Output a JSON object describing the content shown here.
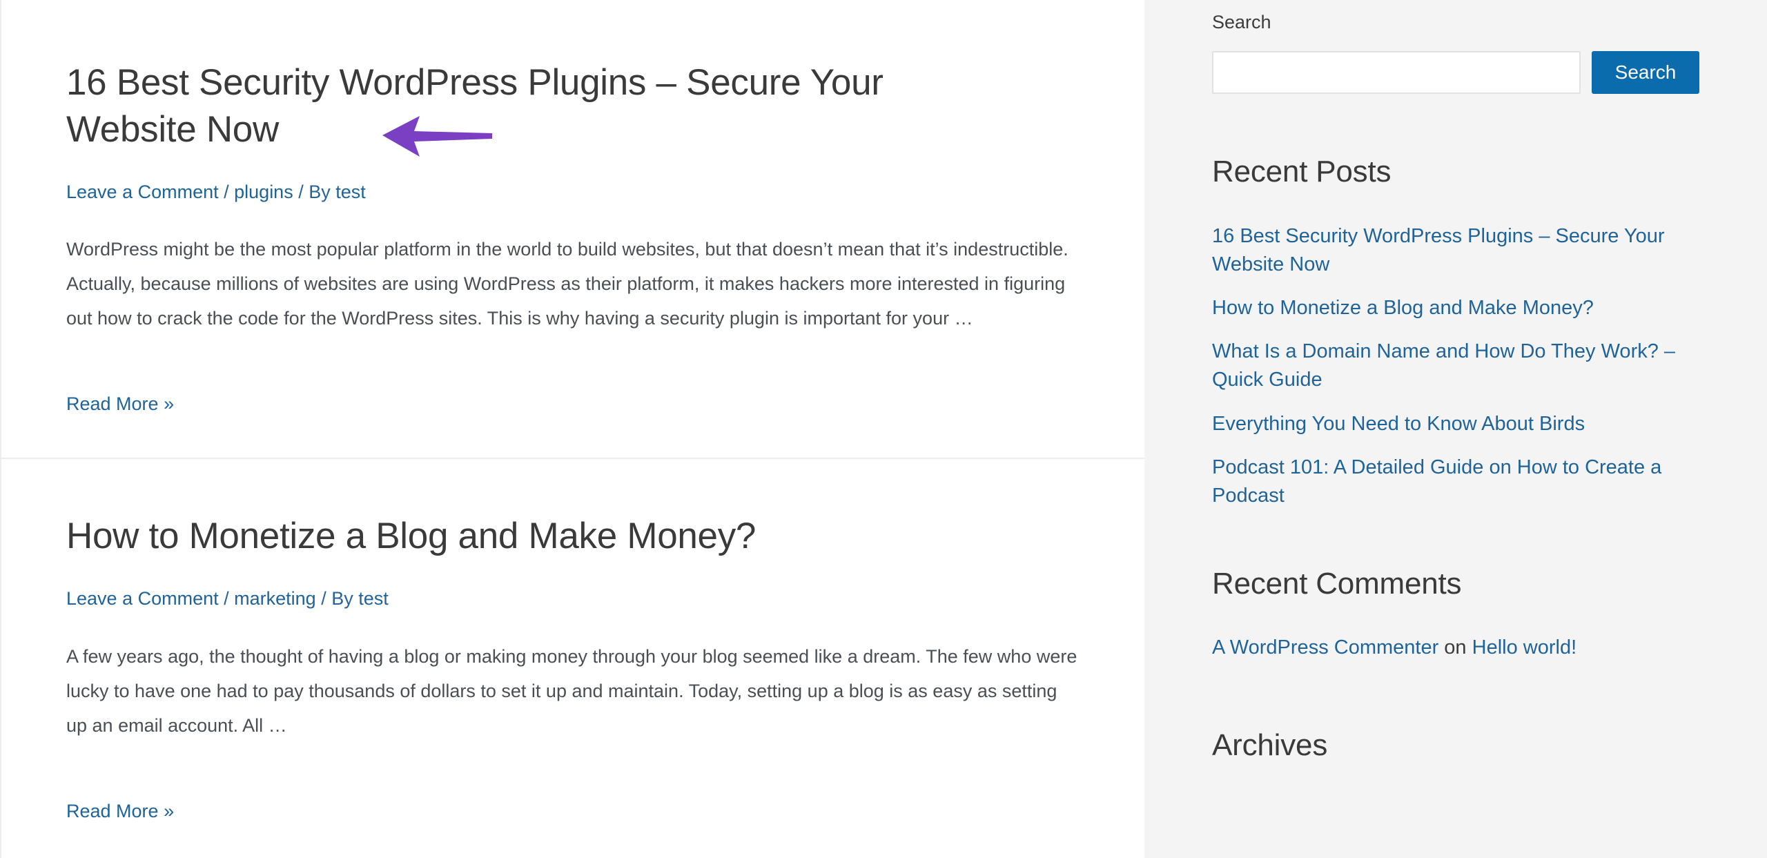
{
  "colors": {
    "accent_blue": "#0b6cad",
    "link_blue": "#1f6399",
    "heading_dark": "#3a3a3a",
    "body_text": "#4a4f54",
    "sidebar_bg": "#f4f4f4",
    "divider": "#ededed",
    "annotation_purple": "#7b3fc4"
  },
  "annotation": {
    "arrow_icon": "left-arrow-annotation",
    "color": "#7b3fc4",
    "direction": "left",
    "points_to": "post-title-1"
  },
  "main": {
    "posts": [
      {
        "title": "16 Best Security WordPress Plugins – Secure Your Website Now",
        "meta": {
          "comment_link": "Leave a Comment",
          "separator": "/",
          "category": "plugins",
          "byline_prefix": "By",
          "author": "test"
        },
        "excerpt": "WordPress might be the most popular platform in the world to build websites, but that doesn’t mean that it’s indestructible.  Actually, because millions of websites are using WordPress as their platform, it makes hackers more interested in figuring out how to crack the code for the WordPress sites. This is why having a security plugin is important for your …",
        "read_more": "Read More »"
      },
      {
        "title": "How to Monetize a Blog and Make Money?",
        "meta": {
          "comment_link": "Leave a Comment",
          "separator": "/",
          "category": "marketing",
          "byline_prefix": "By",
          "author": "test"
        },
        "excerpt": "A few years ago, the thought of having a blog or making money through your blog seemed like a dream. The few who were lucky to have one had to pay thousands of dollars to set it up and maintain. Today, setting up a blog is as easy as setting up an email account. All …",
        "read_more": "Read More »"
      }
    ]
  },
  "sidebar": {
    "search": {
      "label": "Search",
      "input_value": "",
      "placeholder": "",
      "button_label": "Search"
    },
    "recent_posts": {
      "title": "Recent Posts",
      "items": [
        "16 Best Security WordPress Plugins – Secure Your Website Now",
        "How to Monetize a Blog and Make Money?",
        "What Is a Domain Name and How Do They Work? – Quick Guide",
        "Everything You Need to Know About Birds",
        "Podcast 101: A Detailed Guide on How to Create a Podcast"
      ]
    },
    "recent_comments": {
      "title": "Recent Comments",
      "items": [
        {
          "author": "A WordPress Commenter",
          "connector": "on",
          "post": "Hello world!"
        }
      ]
    },
    "archives": {
      "title": "Archives"
    }
  }
}
